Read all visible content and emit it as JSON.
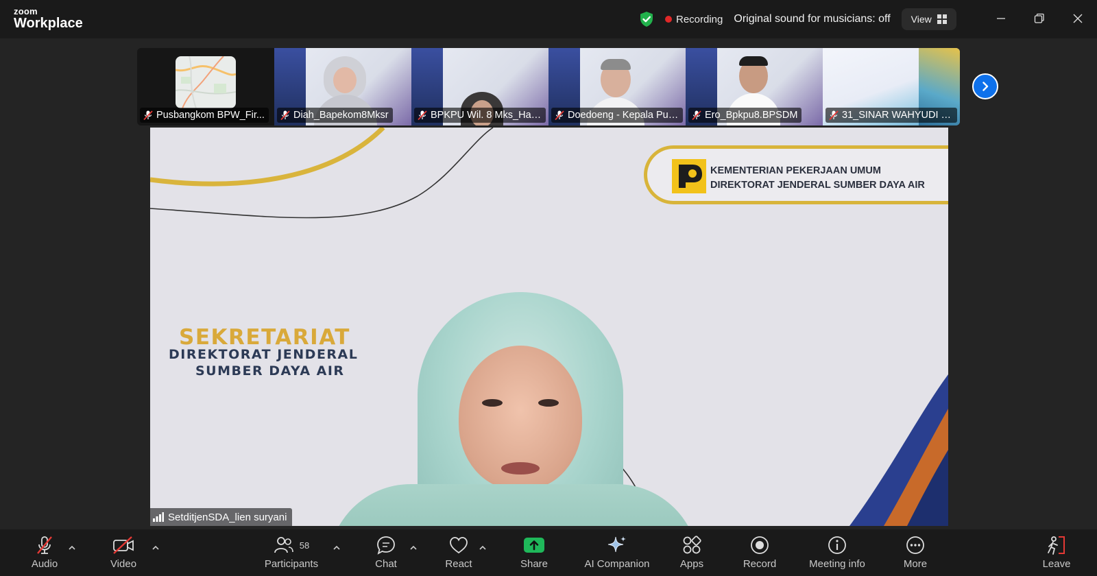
{
  "app": {
    "brand_small": "zoom",
    "brand_large": "Workplace"
  },
  "status": {
    "recording": "Recording",
    "original_sound": "Original sound for musicians: off",
    "view": "View"
  },
  "colors": {
    "accent": "#0e71eb",
    "recording": "#e02828",
    "shield": "#22b14c",
    "share": "#1fb85a",
    "gold": "#d8b43a"
  },
  "participants_strip": [
    {
      "name": "Pusbangkom BPW_Fir...",
      "bg": "map"
    },
    {
      "name": "Diah_Bapekom8Mksr",
      "bg": "person"
    },
    {
      "name": "BPKPU Wil. 8 Mks_Has...",
      "bg": "person"
    },
    {
      "name": "Doedoeng - Kepala Pusb...",
      "bg": "person"
    },
    {
      "name": "Ero_Bpkpu8.BPSDM",
      "bg": "person"
    },
    {
      "name": "31_SINAR WAHYUDI S...",
      "bg": "slide"
    }
  ],
  "main": {
    "speaker": "SetditjenSDA_lien suryani",
    "bg_title": "SEKRETARIAT",
    "bg_sub1": "DIREKTORAT JENDERAL",
    "bg_sub2": "SUMBER DAYA AIR",
    "logo_line1": "KEMENTERIAN PEKERJAAN UMUM",
    "logo_line2": "DIREKTORAT JENDERAL SUMBER DAYA AIR"
  },
  "toolbar": {
    "audio": "Audio",
    "video": "Video",
    "participants": "Participants",
    "participant_count": "58",
    "chat": "Chat",
    "react": "React",
    "share": "Share",
    "ai_companion": "AI Companion",
    "apps": "Apps",
    "record": "Record",
    "meeting_info": "Meeting info",
    "more": "More",
    "leave": "Leave"
  }
}
